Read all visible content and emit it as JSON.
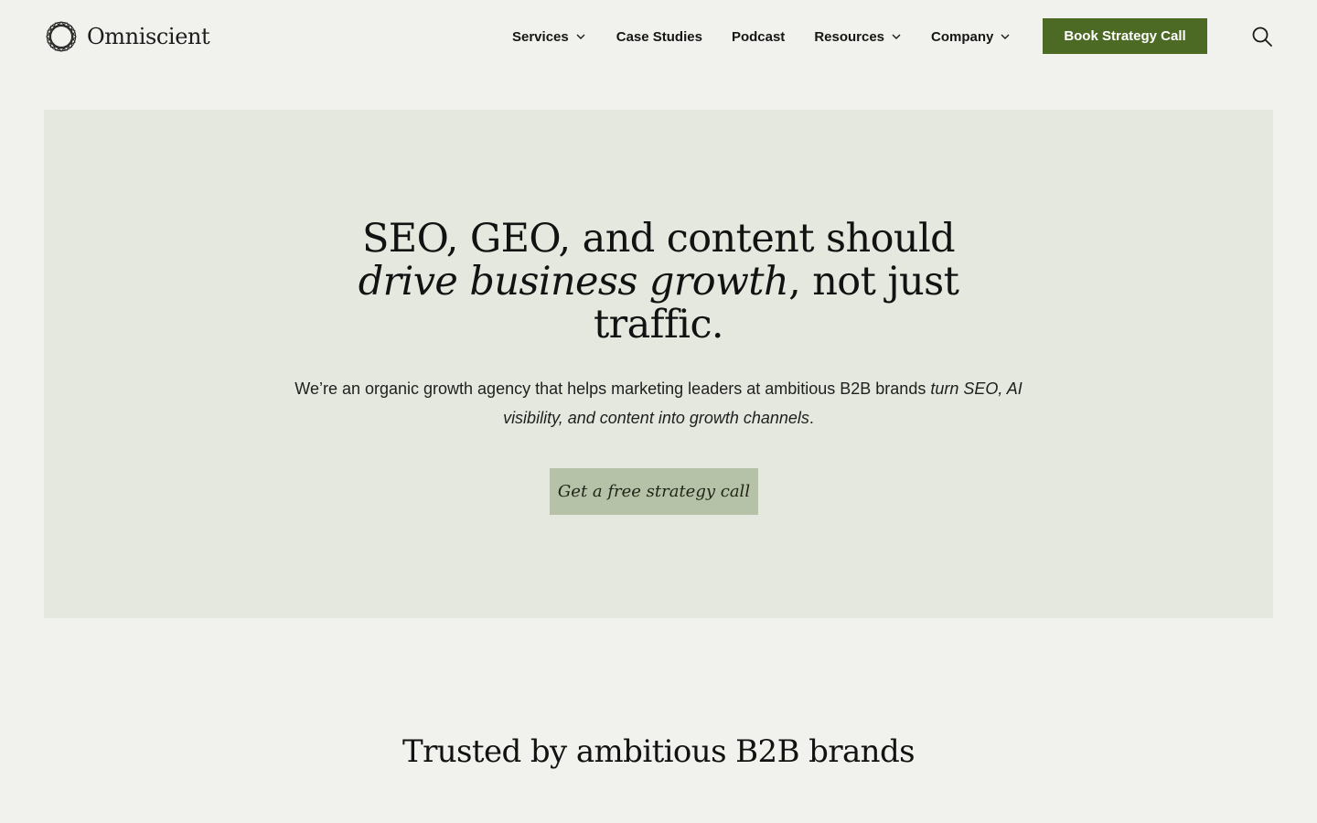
{
  "brand": {
    "name": "Omniscient",
    "logo_icon": "omniscient-geometric-mark-icon"
  },
  "nav": {
    "items": [
      {
        "label": "Services",
        "has_dropdown": true
      },
      {
        "label": "Case Studies",
        "has_dropdown": false
      },
      {
        "label": "Podcast",
        "has_dropdown": false
      },
      {
        "label": "Resources",
        "has_dropdown": true
      },
      {
        "label": "Company",
        "has_dropdown": true
      }
    ],
    "cta_label": "Book Strategy Call",
    "search_icon": "search-icon"
  },
  "hero": {
    "title_line1": "SEO, GEO, and content should",
    "title_italic": "drive business growth",
    "title_rest": ", not just traffic.",
    "subtitle_plain": "We’re an organic growth agency that helps marketing leaders at ambitious B2B brands ",
    "subtitle_italic": "turn SEO, AI visibility, and content into growth channels",
    "subtitle_end": ".",
    "cta_label": "Get a free strategy call"
  },
  "trusted": {
    "heading": "Trusted by ambitious B2B brands"
  },
  "colors": {
    "page_bg": "#f1f2ed",
    "hero_bg": "#e5e8de",
    "primary_button": "#4d6a24",
    "secondary_button": "#b6c2a7",
    "text": "#141414"
  }
}
